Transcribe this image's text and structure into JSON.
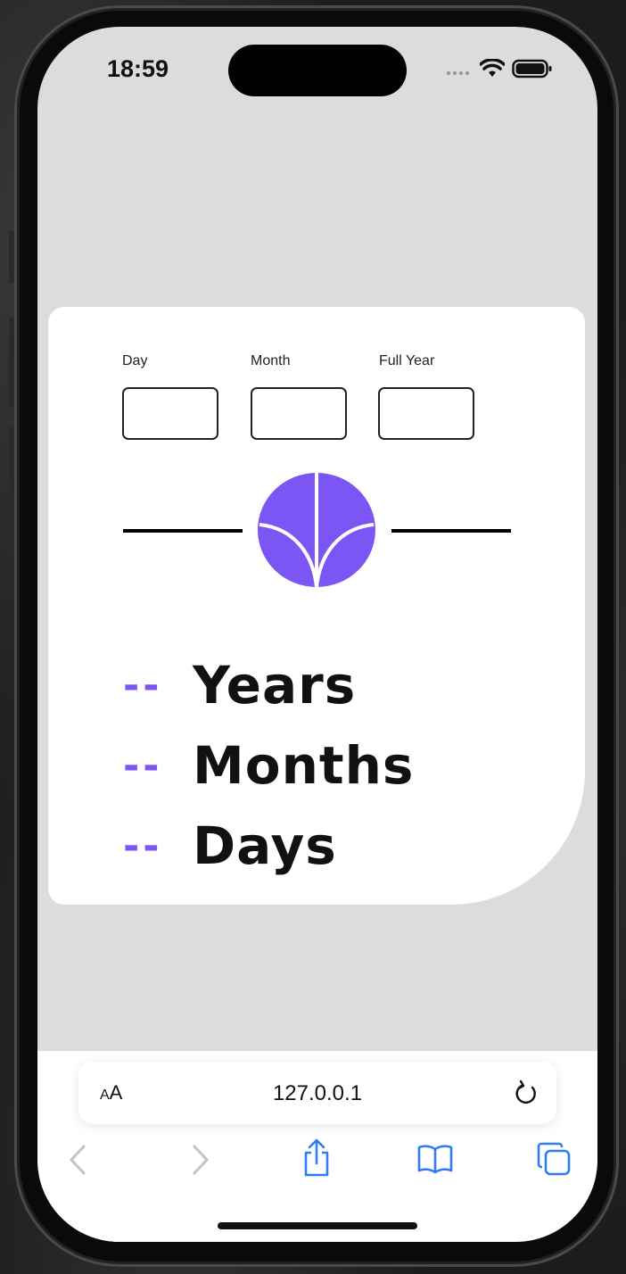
{
  "status_bar": {
    "time": "18:59"
  },
  "form": {
    "day_label": "Day",
    "month_label": "Month",
    "year_label": "Full Year",
    "day_value": "",
    "month_value": "",
    "year_value": ""
  },
  "results": [
    {
      "value": "--",
      "unit": "Years"
    },
    {
      "value": "--",
      "unit": "Months"
    },
    {
      "value": "--",
      "unit": "Days"
    }
  ],
  "browser": {
    "text_size_small": "A",
    "text_size_large": "A",
    "url": "127.0.0.1"
  },
  "icons": {
    "submit": "arrow-down-icon",
    "back": "chevron-left-icon",
    "forward": "chevron-right-icon",
    "share": "share-icon",
    "bookmarks": "book-icon",
    "tabs": "tabs-icon",
    "reload": "reload-icon"
  },
  "colors": {
    "accent": "#7c55f5",
    "page_bg": "#dcdcdc",
    "card_bg": "#ffffff",
    "browser_icon": "#2f7cf6"
  }
}
